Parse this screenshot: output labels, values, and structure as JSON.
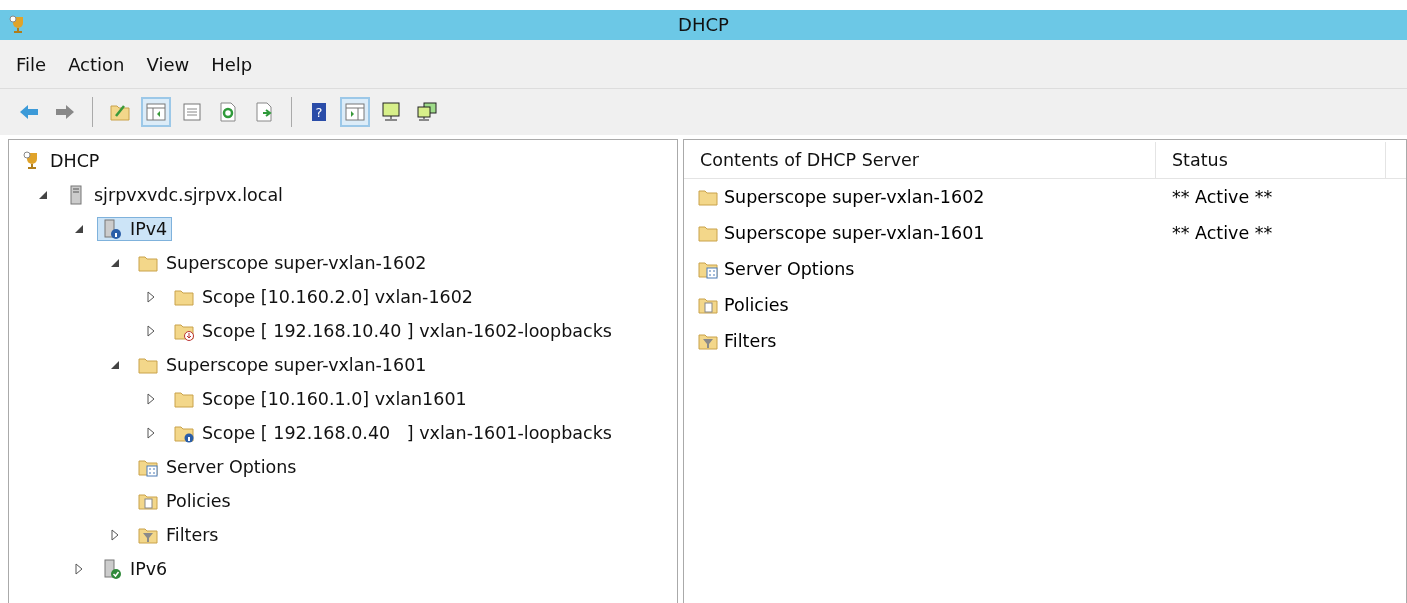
{
  "window": {
    "title": "DHCP"
  },
  "menu": [
    "File",
    "Action",
    "View",
    "Help"
  ],
  "toolbar": [
    {
      "kind": "back",
      "pressed": false
    },
    {
      "kind": "forward",
      "pressed": false
    },
    {
      "kind": "separator"
    },
    {
      "kind": "up",
      "pressed": false
    },
    {
      "kind": "tree",
      "pressed": true
    },
    {
      "kind": "properties",
      "pressed": false
    },
    {
      "kind": "refresh",
      "pressed": false
    },
    {
      "kind": "export",
      "pressed": false
    },
    {
      "kind": "separator"
    },
    {
      "kind": "help",
      "label": "?",
      "pressed": false
    },
    {
      "kind": "actionpane",
      "pressed": true
    },
    {
      "kind": "monitor",
      "pressed": false
    },
    {
      "kind": "monitors",
      "pressed": false
    }
  ],
  "tree": [
    {
      "label": "DHCP",
      "kind": "dhcp",
      "selected": false,
      "children": [
        {
          "label": "sjrpvxvdc.sjrpvx.local",
          "kind": "server",
          "expanded": true,
          "selected": false,
          "children": [
            {
              "label": "IPv4",
              "kind": "ipv4",
              "expanded": true,
              "selected": true,
              "children": [
                {
                  "label": "Superscope super-vxlan-1602",
                  "kind": "folder",
                  "expanded": true,
                  "selected": false,
                  "children": [
                    {
                      "label": "Scope [10.160.2.0] vxlan-1602",
                      "kind": "folder",
                      "expanded": false,
                      "selected": false
                    },
                    {
                      "label": "Scope [ 192.168.10.40 ] vxlan-1602-loopbacks",
                      "kind": "scopedown",
                      "expanded": false,
                      "selected": false
                    }
                  ]
                },
                {
                  "label": "Superscope super-vxlan-1601",
                  "kind": "folder",
                  "expanded": true,
                  "selected": false,
                  "children": [
                    {
                      "label": "Scope [10.160.1.0] vxlan1601",
                      "kind": "folder",
                      "expanded": false,
                      "selected": false
                    },
                    {
                      "label": "Scope [ 192.168.0.40   ] vxlan-1601-loopbacks",
                      "kind": "scopeinfo",
                      "expanded": false,
                      "selected": false
                    }
                  ]
                },
                {
                  "label": "Server Options",
                  "kind": "options",
                  "selected": false
                },
                {
                  "label": "Policies",
                  "kind": "policies",
                  "selected": false
                },
                {
                  "label": "Filters",
                  "kind": "filters",
                  "expanded": false,
                  "selected": false
                }
              ]
            },
            {
              "label": "IPv6",
              "kind": "ipv6",
              "expanded": false,
              "selected": false
            }
          ]
        }
      ]
    }
  ],
  "list": {
    "columns": [
      "Contents of DHCP Server",
      "Status"
    ],
    "rows": [
      {
        "name": "Superscope super-vxlan-1602",
        "kind": "folder",
        "status": "** Active **"
      },
      {
        "name": "Superscope super-vxlan-1601",
        "kind": "folder",
        "status": "** Active **"
      },
      {
        "name": "Server Options",
        "kind": "options"
      },
      {
        "name": "Policies",
        "kind": "policies"
      },
      {
        "name": "Filters",
        "kind": "filters"
      }
    ]
  }
}
